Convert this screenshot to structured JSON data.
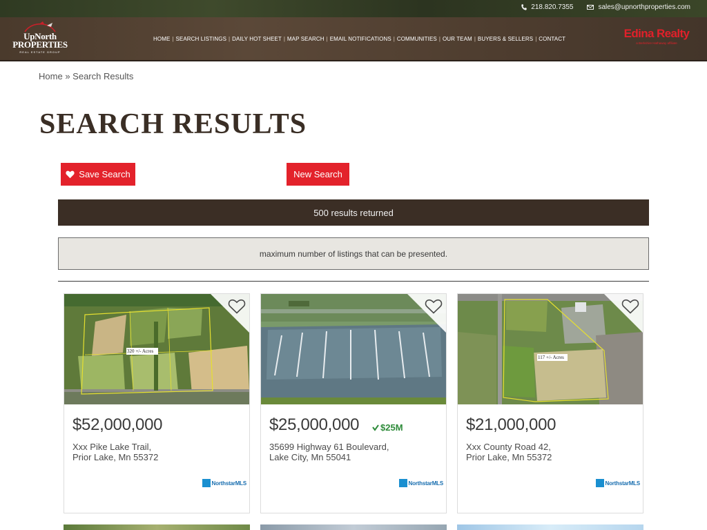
{
  "topbar": {
    "phone": "218.820.7355",
    "email": "sales@upnorthproperties.com",
    "icons": [
      "phone-icon",
      "mail-icon"
    ]
  },
  "header": {
    "logo": {
      "line1": "UpNorth",
      "line2": "PROPERTIES",
      "line3": "REAL ESTATE GROUP"
    },
    "nav": [
      "HOME",
      "SEARCH LISTINGS",
      "DAILY HOT SHEET",
      "MAP SEARCH",
      "EMAIL NOTIFICATIONS",
      "COMMUNITIES",
      "OUR TEAM",
      "BUYERS & SELLERS",
      "CONTACT"
    ],
    "brand": {
      "name": "Edina Realty",
      "tagline": "a Berkshire Hathaway affiliate"
    }
  },
  "breadcrumb": {
    "home": "Home",
    "sep": "»",
    "current": "Search Results"
  },
  "page_title": "SEARCH RESULTS",
  "actions": {
    "save_search": "Save Search",
    "new_search": "New Search"
  },
  "results": {
    "count_text": "500 results returned",
    "notice": "maximum number of listings that can be presented."
  },
  "listings": [
    {
      "price": "$52,000,000",
      "drop": "",
      "address_line1": "Xxx Pike Lake Trail,",
      "address_line2": "Prior Lake, Mn 55372",
      "photo_label": "320 +/- Acres",
      "mls": "NorthstarMLS"
    },
    {
      "price": "$25,000,000",
      "drop": "$25M",
      "address_line1": "35699 Highway 61 Boulevard,",
      "address_line2": "Lake City, Mn 55041",
      "photo_label": "",
      "mls": "NorthstarMLS"
    },
    {
      "price": "$21,000,000",
      "drop": "",
      "address_line1": "Xxx County Road 42,",
      "address_line2": "Prior Lake, Mn 55372",
      "photo_label": "117 +/- Acres",
      "mls": "NorthstarMLS"
    }
  ],
  "colors": {
    "accent_red": "#e3222b",
    "brown_dark": "#3b2e25",
    "price_drop_green": "#2e8b3a",
    "mls_blue": "#1a8fd0"
  }
}
